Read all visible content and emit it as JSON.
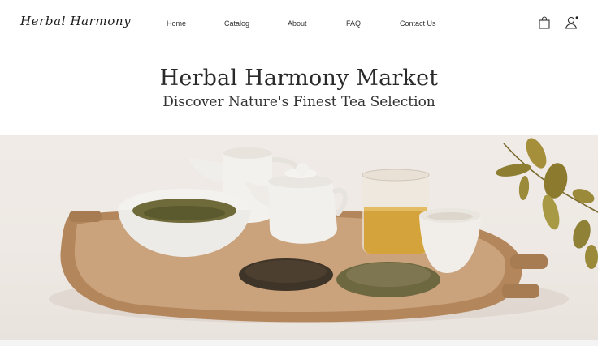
{
  "header": {
    "logo": "Herbal Harmony",
    "nav": [
      "Home",
      "Catalog",
      "About",
      "FAQ",
      "Contact Us"
    ],
    "icons": [
      "shopping-bag-icon",
      "user-account-icon"
    ]
  },
  "hero": {
    "title": "Herbal Harmony Market",
    "subtitle": "Discover Nature's Finest Tea Selection"
  },
  "banner": {
    "image": "tea-set-on-wooden-tray"
  }
}
